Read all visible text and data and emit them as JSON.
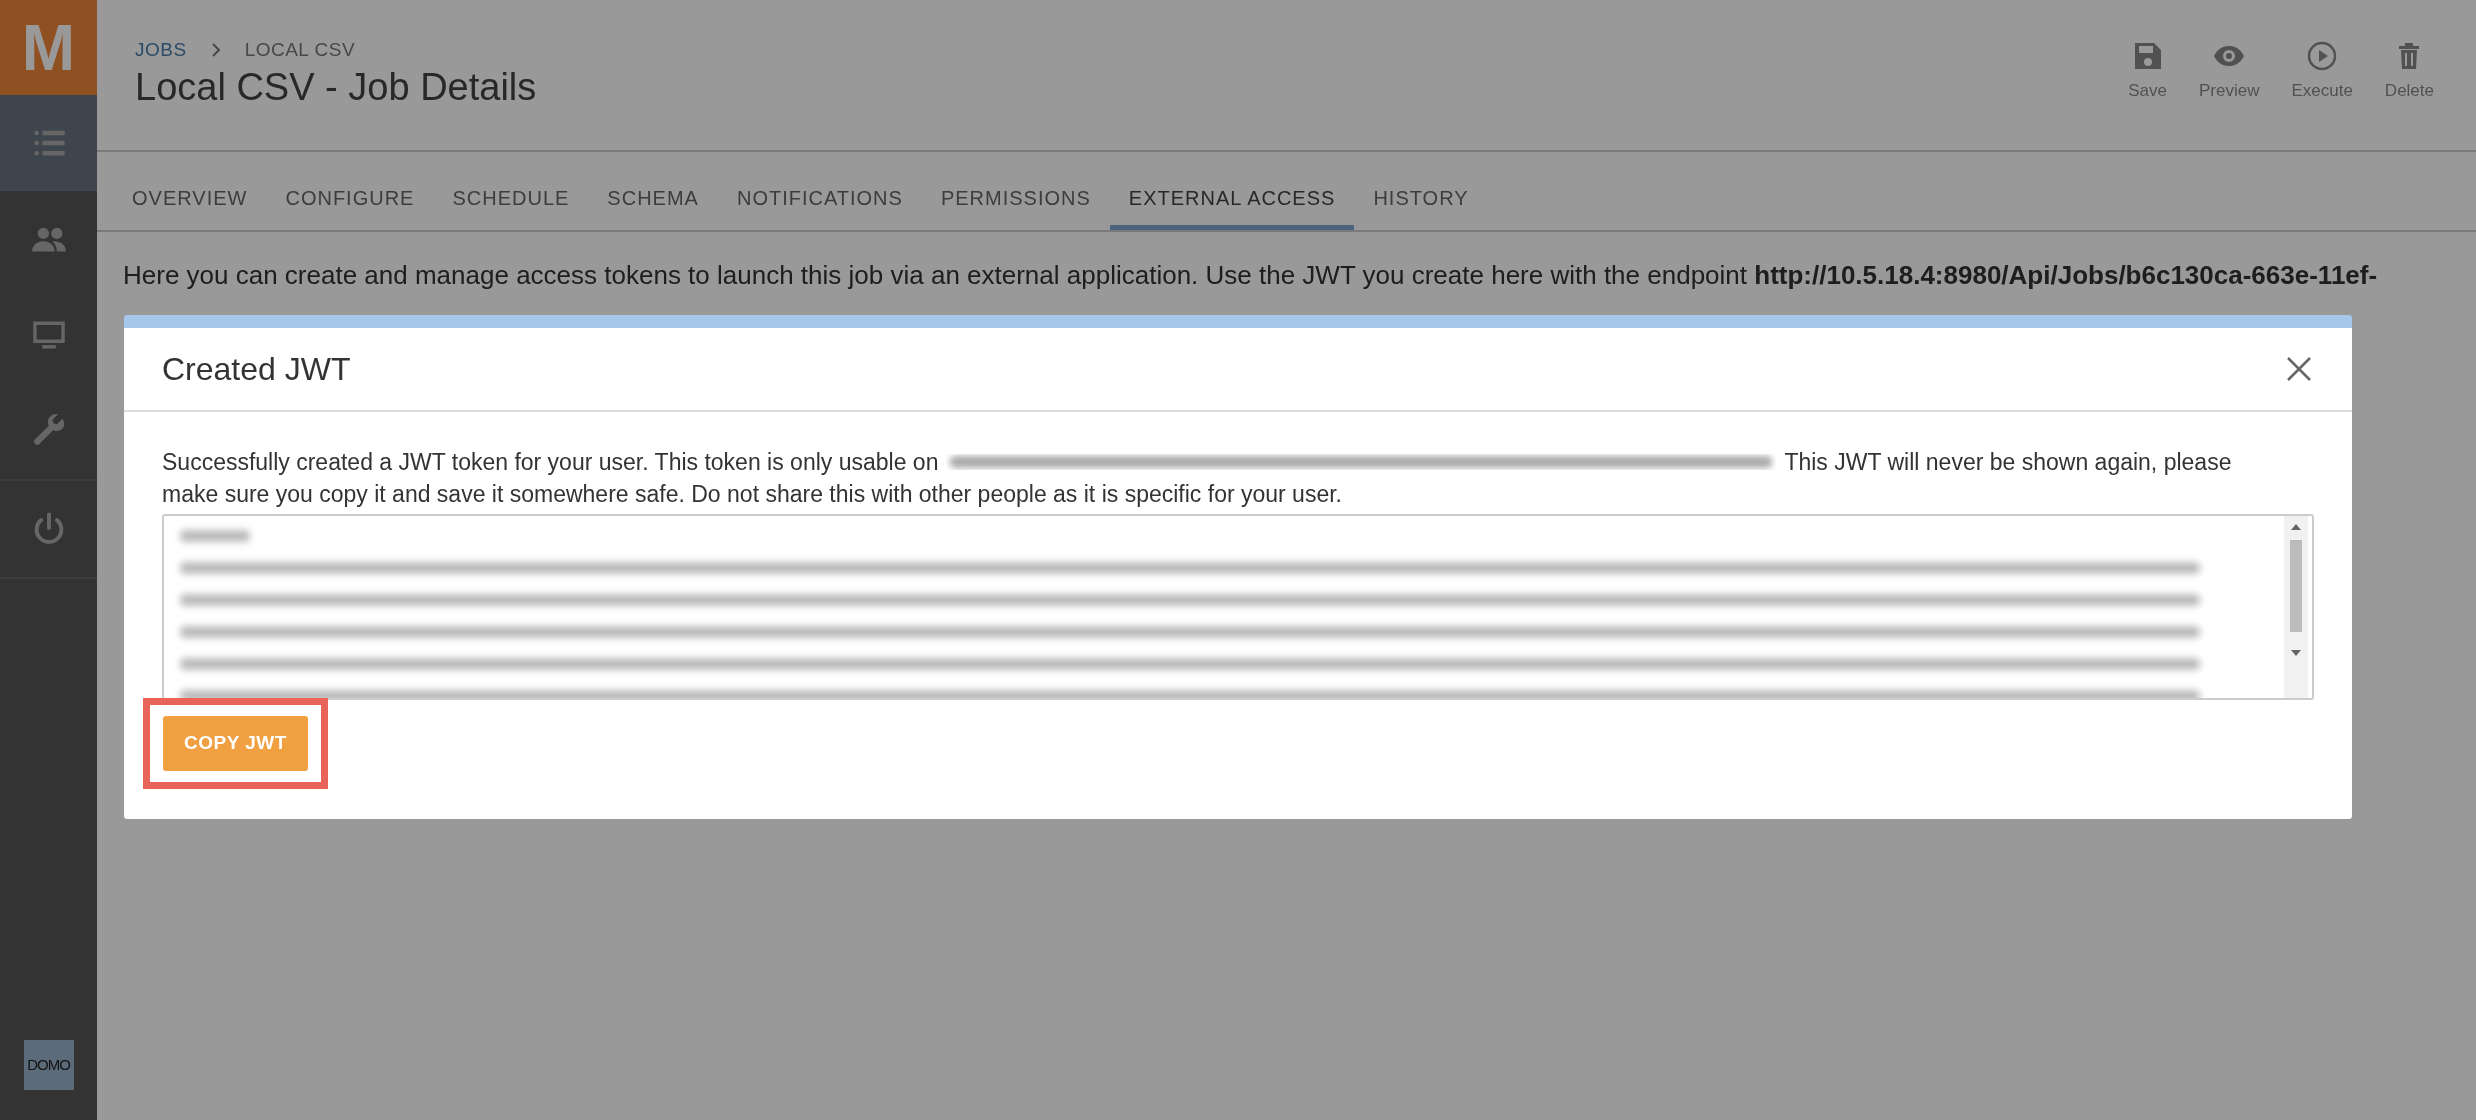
{
  "brand": {
    "logo": "M",
    "footer_logo": "DOMO"
  },
  "sidebar": {
    "groups": [
      {
        "items": [
          {
            "kind": "list",
            "selected": true
          },
          {
            "kind": "users",
            "selected": false
          },
          {
            "kind": "monitor",
            "selected": false
          },
          {
            "kind": "wrench",
            "selected": false
          }
        ]
      },
      {
        "items": [
          {
            "kind": "power",
            "selected": false
          }
        ]
      }
    ]
  },
  "header": {
    "breadcrumb": [
      "JOBS",
      "LOCAL CSV"
    ],
    "title": "Local CSV - Job Details",
    "actions": [
      {
        "kind": "save",
        "label": "Save"
      },
      {
        "kind": "preview",
        "label": "Preview"
      },
      {
        "kind": "execute",
        "label": "Execute"
      },
      {
        "kind": "delete",
        "label": "Delete"
      }
    ]
  },
  "tabs": [
    {
      "label": "OVERVIEW",
      "selected": false
    },
    {
      "label": "CONFIGURE",
      "selected": false
    },
    {
      "label": "SCHEDULE",
      "selected": false
    },
    {
      "label": "SCHEMA",
      "selected": false
    },
    {
      "label": "NOTIFICATIONS",
      "selected": false
    },
    {
      "label": "PERMISSIONS",
      "selected": false
    },
    {
      "label": "EXTERNAL ACCESS",
      "selected": true
    },
    {
      "label": "HISTORY",
      "selected": false
    }
  ],
  "intro": "Here you can create and manage access tokens to launch this job via an external application. Use the JWT you create here with the endpoint **http://10.5.18.4:8980/Api/Jobs/b6c130ca-663e-11ef-**",
  "modal": {
    "title": "Created JWT",
    "message_before": "Successfully created a JWT token for your user. This token is only usable on",
    "message_after": "This JWT will never be shown again, please",
    "message_line2": "make sure you copy it and save it somewhere safe. Do not share this with other people as it is specific for your user.",
    "copy_button": {
      "label": "COPY JWT",
      "highlighted": true
    }
  }
}
